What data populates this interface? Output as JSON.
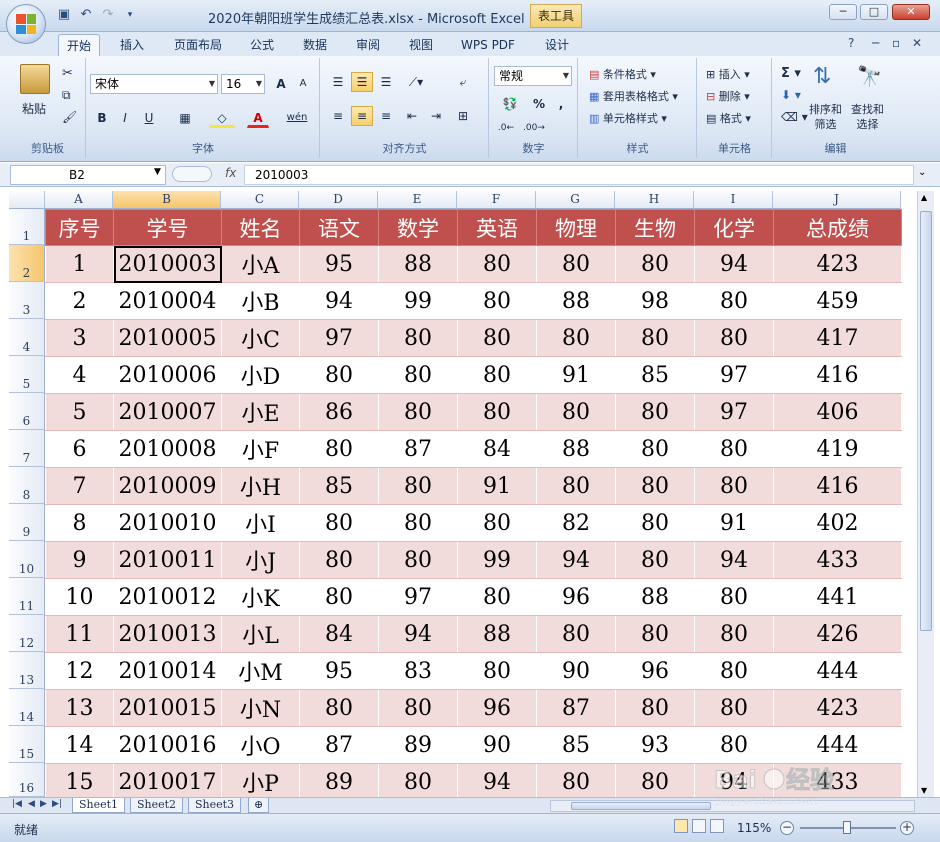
{
  "window": {
    "title": "2020年朝阳班学生成绩汇总表.xlsx - Microsoft Excel",
    "context_tab_title": "表工具",
    "minimize": "─",
    "maximize": "□",
    "close": "✕"
  },
  "qat": {
    "save": "💾",
    "undo": "↶",
    "redo": "↷",
    "customize": "▾"
  },
  "tabs": [
    "开始",
    "插入",
    "页面布局",
    "公式",
    "数据",
    "审阅",
    "视图",
    "WPS PDF",
    "设计"
  ],
  "active_tab": "开始",
  "ribbon": {
    "clipboard": {
      "label": "剪贴板",
      "paste": "粘贴"
    },
    "font": {
      "label": "字体",
      "font_name": "宋体",
      "font_size": "16",
      "grow": "A",
      "shrink": "A",
      "bold": "B",
      "italic": "I",
      "underline": "U",
      "phonetic": "wén"
    },
    "alignment": {
      "label": "对齐方式"
    },
    "number": {
      "label": "数字",
      "format": "常规",
      "percent": "%",
      "comma": ","
    },
    "styles": {
      "label": "样式",
      "conditional": "条件格式",
      "table": "套用表格格式",
      "cell_styles": "单元格样式"
    },
    "cells": {
      "label": "单元格",
      "insert": "插入",
      "delete": "删除",
      "format": "格式"
    },
    "editing": {
      "label": "编辑",
      "sort": "排序和\n筛选",
      "sort_line1": "排序和",
      "sort_line2": "筛选",
      "find_line1": "查找和",
      "find_line2": "选择"
    }
  },
  "formula_bar": {
    "name_box": "B2",
    "fx": "fx",
    "content": "2010003"
  },
  "columns": [
    "A",
    "B",
    "C",
    "D",
    "E",
    "F",
    "G",
    "H",
    "I",
    "J"
  ],
  "selected_column": "B",
  "selected_row": 2,
  "row_numbers": [
    1,
    2,
    3,
    4,
    5,
    6,
    7,
    8,
    9,
    10,
    11,
    12,
    13,
    14,
    15,
    16
  ],
  "table": {
    "headers": [
      "序号",
      "学号",
      "姓名",
      "语文",
      "数学",
      "英语",
      "物理",
      "生物",
      "化学",
      "总成绩"
    ],
    "rows": [
      [
        "1",
        "2010003",
        "小A",
        "95",
        "88",
        "80",
        "80",
        "80",
        "94",
        "423"
      ],
      [
        "2",
        "2010004",
        "小B",
        "94",
        "99",
        "80",
        "88",
        "98",
        "80",
        "459"
      ],
      [
        "3",
        "2010005",
        "小C",
        "97",
        "80",
        "80",
        "80",
        "80",
        "80",
        "417"
      ],
      [
        "4",
        "2010006",
        "小D",
        "80",
        "80",
        "80",
        "91",
        "85",
        "97",
        "416"
      ],
      [
        "5",
        "2010007",
        "小E",
        "86",
        "80",
        "80",
        "80",
        "80",
        "97",
        "406"
      ],
      [
        "6",
        "2010008",
        "小F",
        "80",
        "87",
        "84",
        "88",
        "80",
        "80",
        "419"
      ],
      [
        "7",
        "2010009",
        "小H",
        "85",
        "80",
        "91",
        "80",
        "80",
        "80",
        "416"
      ],
      [
        "8",
        "2010010",
        "小I",
        "80",
        "80",
        "80",
        "82",
        "80",
        "91",
        "402"
      ],
      [
        "9",
        "2010011",
        "小J",
        "80",
        "80",
        "99",
        "94",
        "80",
        "94",
        "433"
      ],
      [
        "10",
        "2010012",
        "小K",
        "80",
        "97",
        "80",
        "96",
        "88",
        "80",
        "441"
      ],
      [
        "11",
        "2010013",
        "小L",
        "84",
        "94",
        "88",
        "80",
        "80",
        "80",
        "426"
      ],
      [
        "12",
        "2010014",
        "小M",
        "95",
        "83",
        "80",
        "90",
        "96",
        "80",
        "444"
      ],
      [
        "13",
        "2010015",
        "小N",
        "80",
        "80",
        "96",
        "87",
        "80",
        "80",
        "423"
      ],
      [
        "14",
        "2010016",
        "小O",
        "87",
        "89",
        "90",
        "85",
        "93",
        "80",
        "444"
      ],
      [
        "15",
        "2010017",
        "小P",
        "89",
        "80",
        "94",
        "80",
        "80",
        "94",
        "433"
      ]
    ]
  },
  "sheet_tabs": [
    "Sheet1",
    "Sheet2",
    "Sheet3"
  ],
  "active_sheet": "Sheet1",
  "status": {
    "text": "就绪",
    "zoom": "115%"
  },
  "watermark": {
    "text": "Baidu经验",
    "url": "jingyan.baidu.com"
  },
  "colors": {
    "header_fill": "#c0504d",
    "band_fill": "#f2dcdb",
    "selection_orange": "#f6c56a"
  }
}
